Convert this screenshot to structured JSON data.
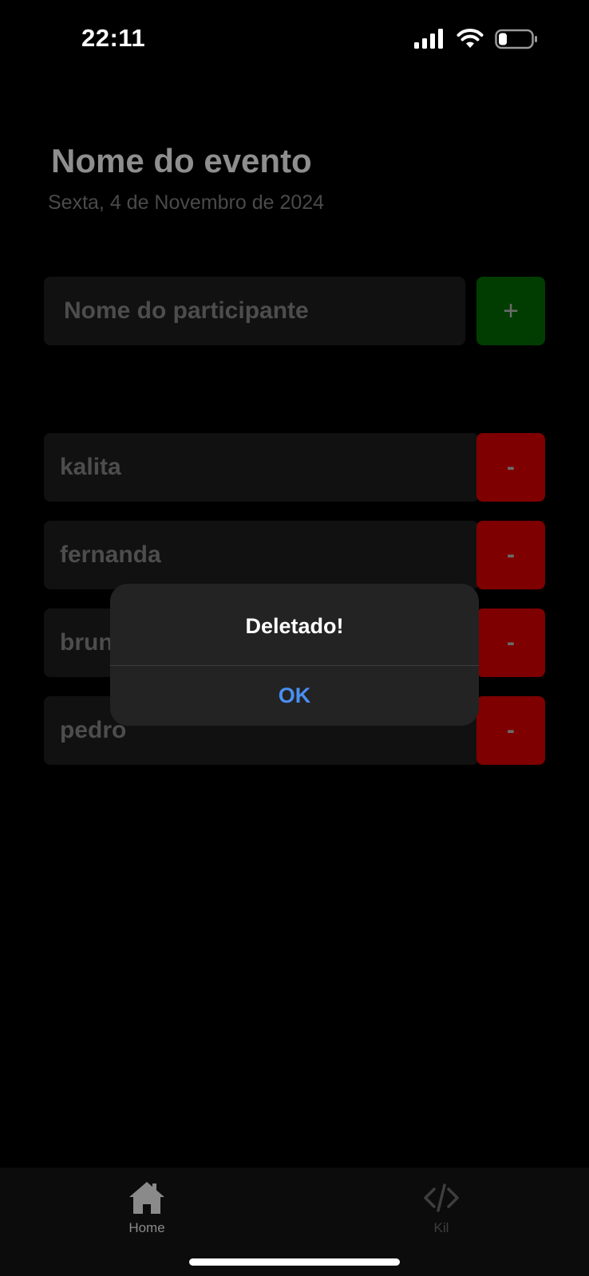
{
  "status_bar": {
    "time": "22:11",
    "icons": [
      "signal-icon",
      "wifi-icon",
      "battery-icon"
    ]
  },
  "event": {
    "title": "Nome do evento",
    "date": "Sexta, 4 de Novembro de 2024"
  },
  "add_form": {
    "placeholder": "Nome do participante",
    "add_button_label": "+"
  },
  "participants": [
    {
      "name": "kalita",
      "remove_label": "-"
    },
    {
      "name": "fernanda",
      "remove_label": "-"
    },
    {
      "name": "bruno",
      "remove_label": "-"
    },
    {
      "name": "pedro",
      "remove_label": "-"
    }
  ],
  "alert": {
    "title": "Deletado!",
    "button_label": "OK"
  },
  "tab_bar": {
    "tabs": [
      {
        "label": "Home",
        "icon": "home-icon",
        "active": true
      },
      {
        "label": "Kil",
        "icon": "code-icon",
        "active": false
      }
    ]
  },
  "colors": {
    "add_button": "#013d01",
    "remove_button": "#7e0000",
    "alert_button": "#4a8ff0"
  }
}
